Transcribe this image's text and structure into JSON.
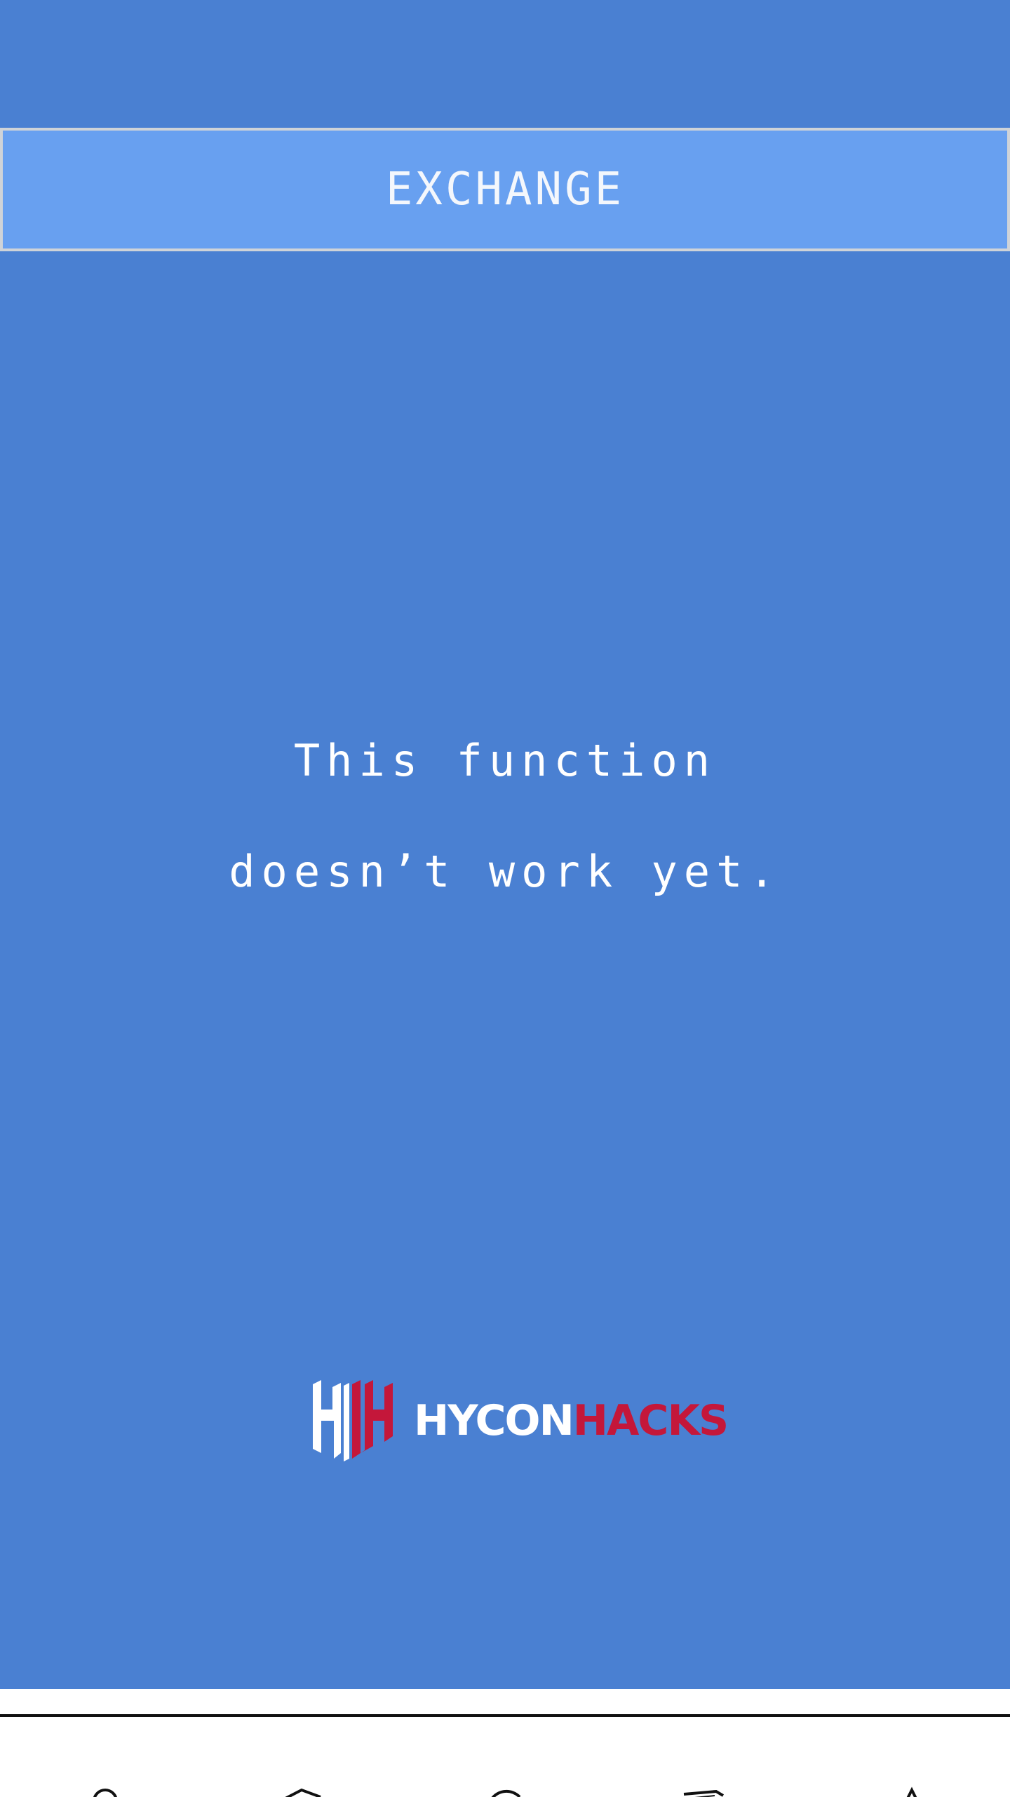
{
  "header": {
    "title": "EXCHANGE"
  },
  "message": {
    "line1": "This function",
    "line2": "doesn’t work yet."
  },
  "logo": {
    "mark": "hycon-hh-mark",
    "text_white": "HYCON",
    "text_red": "HACKS"
  },
  "bottom_nav": {
    "items": [
      {
        "icon": "wallet-icon"
      },
      {
        "icon": "shield-icon"
      },
      {
        "icon": "refresh-icon"
      },
      {
        "icon": "chat-icon"
      },
      {
        "icon": "user-icon"
      }
    ]
  },
  "colors": {
    "background": "#4a80d2",
    "header_bar": "#68a0f0",
    "header_border": "#cfd3d8",
    "logo_red": "#c4173a",
    "text": "#ffffff"
  }
}
